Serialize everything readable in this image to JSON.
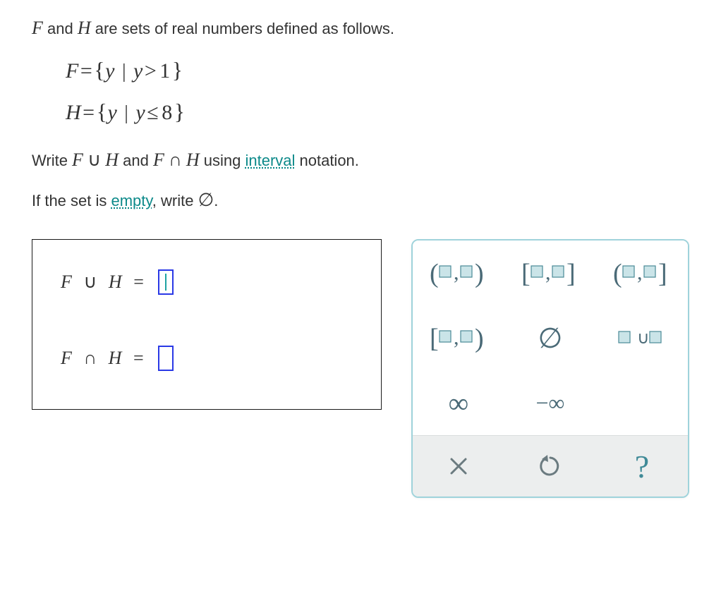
{
  "prompt": {
    "line1_pre": "",
    "var1": "F",
    "line1_mid": " and ",
    "var2": "H",
    "line1_post": " are sets of real numbers defined as follows."
  },
  "sets": {
    "F": {
      "lhs": "F",
      "var": "y",
      "rel": ">",
      "val": "1"
    },
    "H": {
      "lhs": "H",
      "var": "y",
      "rel": "≤",
      "val": "8"
    }
  },
  "instruct": {
    "write": "Write ",
    "expr1_a": "F",
    "expr1_op": "∪",
    "expr1_b": "H",
    "and": " and ",
    "expr2_a": "F",
    "expr2_op": "∩",
    "expr2_b": "H",
    "using": " using ",
    "interval_link": "interval",
    "notation": " notation.",
    "line2_pre": "If the set is ",
    "empty_link": "empty",
    "line2_mid": ", write ",
    "empty_sym": "∅",
    "line2_end": "."
  },
  "answers": {
    "row1": {
      "a": "F",
      "op": "∪",
      "b": "H",
      "eq": "="
    },
    "row2": {
      "a": "F",
      "op": "∩",
      "b": "H",
      "eq": "="
    }
  },
  "keypad": {
    "open_open": "( , )",
    "closed_closed": "[ , ]",
    "open_closed": "( , ]",
    "closed_open": "[ , )",
    "empty": "∅",
    "union": "∪",
    "infinity": "∞",
    "neg_infinity": "−∞",
    "clear": "×",
    "undo": "↺",
    "help": "?"
  }
}
